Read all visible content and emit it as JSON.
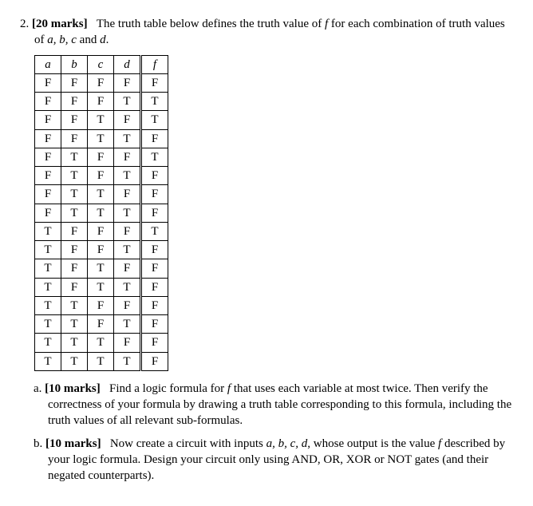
{
  "question": {
    "number": "2.",
    "marks": "[20 marks]",
    "intro_text_1": "The truth table below defines the truth value of ",
    "intro_var_f": "f",
    "intro_text_2": " for each combination of truth values of ",
    "intro_vars": "a, b, c",
    "intro_text_3": " and ",
    "intro_var_d": "d",
    "intro_text_4": "."
  },
  "table": {
    "headers": [
      "a",
      "b",
      "c",
      "d",
      "f"
    ],
    "rows": [
      [
        "F",
        "F",
        "F",
        "F",
        "F"
      ],
      [
        "F",
        "F",
        "F",
        "T",
        "T"
      ],
      [
        "F",
        "F",
        "T",
        "F",
        "T"
      ],
      [
        "F",
        "F",
        "T",
        "T",
        "F"
      ],
      [
        "F",
        "T",
        "F",
        "F",
        "T"
      ],
      [
        "F",
        "T",
        "F",
        "T",
        "F"
      ],
      [
        "F",
        "T",
        "T",
        "F",
        "F"
      ],
      [
        "F",
        "T",
        "T",
        "T",
        "F"
      ],
      [
        "T",
        "F",
        "F",
        "F",
        "T"
      ],
      [
        "T",
        "F",
        "F",
        "T",
        "F"
      ],
      [
        "T",
        "F",
        "T",
        "F",
        "F"
      ],
      [
        "T",
        "F",
        "T",
        "T",
        "F"
      ],
      [
        "T",
        "T",
        "F",
        "F",
        "F"
      ],
      [
        "T",
        "T",
        "F",
        "T",
        "F"
      ],
      [
        "T",
        "T",
        "T",
        "F",
        "F"
      ],
      [
        "T",
        "T",
        "T",
        "T",
        "F"
      ]
    ]
  },
  "part_a": {
    "label": "a.",
    "marks": "[10 marks]",
    "text_1": "Find a logic formula for ",
    "var_f": "f",
    "text_2": " that uses each variable at most twice. Then verify the correctness of your formula by drawing a truth table corresponding to this formula, including the truth values of all relevant sub-formulas."
  },
  "part_b": {
    "label": "b.",
    "marks": "[10 marks]",
    "text_1": "Now create a circuit with inputs ",
    "vars": "a, b, c, d",
    "text_2": ", whose output is the value ",
    "var_f": "f",
    "text_3": " described by your logic formula. Design your circuit only using AND, OR, XOR or NOT gates (and their negated counterparts)."
  }
}
